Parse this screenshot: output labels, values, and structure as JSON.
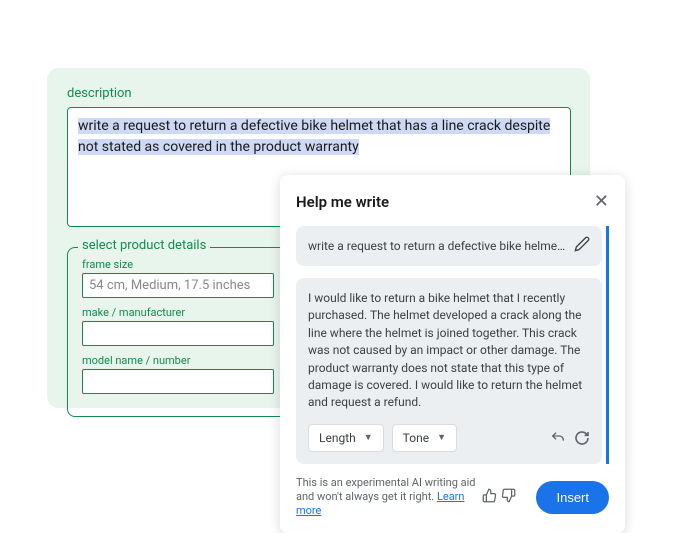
{
  "form": {
    "descLabel": "description",
    "descText": "write a request to return a defective bike helmet that has a line crack despite not stated as covered in the product warranty",
    "productLegend": "select product details",
    "fields": {
      "frameSize": {
        "label": "frame size",
        "value": "54 cm, Medium, 17.5 inches"
      },
      "make": {
        "label": "make / manufacturer",
        "value": ""
      },
      "model": {
        "label": "model name / number",
        "value": ""
      }
    }
  },
  "popup": {
    "title": "Help me write",
    "promptText": "write a request to return a defective bike helmet that has a...",
    "resultText": "I would like to return a bike helmet that I recently purchased. The helmet developed a crack along the line where the helmet is joined together. This crack was not caused by an impact or other damage. The product warranty does not state that this type of damage is covered. I would like to return the helmet and request a refund.",
    "lengthBtn": "Length",
    "toneBtn": "Tone",
    "footerText": "This is an experimental AI writing aid and won't always get it right. ",
    "learnMore": "Learn more",
    "insertBtn": "Insert"
  }
}
